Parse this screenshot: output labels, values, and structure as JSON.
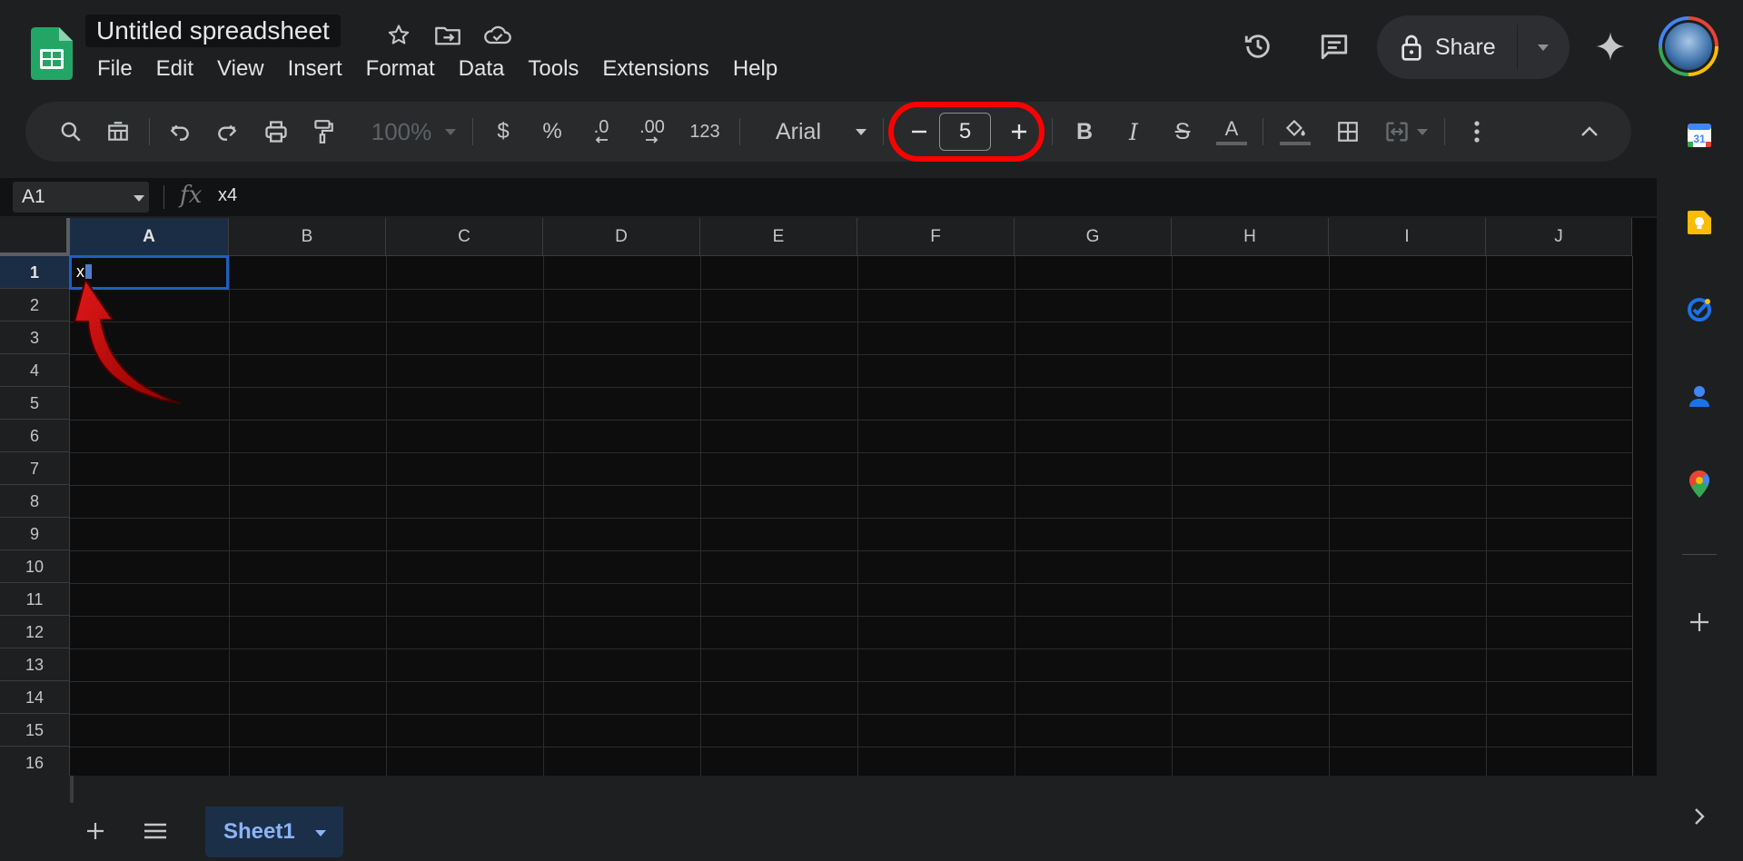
{
  "app": {
    "title": "Untitled spreadsheet",
    "menu": [
      "File",
      "Edit",
      "View",
      "Insert",
      "Format",
      "Data",
      "Tools",
      "Extensions",
      "Help"
    ],
    "share_label": "Share"
  },
  "toolbar": {
    "zoom": "100%",
    "currency": "$",
    "percent": "%",
    "decrease_decimal": ".0",
    "increase_decimal": ".00",
    "number_format": "123",
    "font": "Arial",
    "font_size": "5",
    "bold": "B",
    "italic": "I",
    "strike": "S",
    "text_color": "A"
  },
  "formula_bar": {
    "name_box": "A1",
    "fx": "fx",
    "value": "x4"
  },
  "grid": {
    "columns": [
      "A",
      "B",
      "C",
      "D",
      "E",
      "F",
      "G",
      "H",
      "I",
      "J"
    ],
    "rows": [
      "1",
      "2",
      "3",
      "4",
      "5",
      "6",
      "7",
      "8",
      "9",
      "10",
      "11",
      "12",
      "13",
      "14",
      "15",
      "16"
    ],
    "selected_column": "A",
    "selected_row": "1",
    "active_cell_text": "x"
  },
  "sheets": {
    "tabs": [
      "Sheet1"
    ]
  },
  "colors": {
    "accent": "#8ab4f8",
    "annotation": "#ff0000",
    "selection": "#1f5fbf"
  },
  "side_panel": {
    "calendar_day": "31"
  }
}
